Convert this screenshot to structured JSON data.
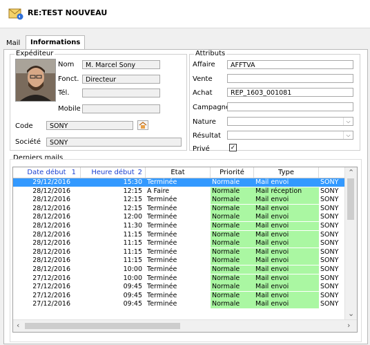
{
  "window": {
    "title": "RE:TEST NOUVEAU"
  },
  "tabs": [
    {
      "label": "Mail"
    },
    {
      "label": "Informations"
    }
  ],
  "expediteur": {
    "title": "Expéditeur",
    "nom_label": "Nom",
    "nom": "M. Marcel Sony",
    "fonct_label": "Fonct.",
    "fonct": "Directeur",
    "tel_label": "Tél.",
    "tel": "",
    "mobile_label": "Mobile",
    "mobile": "",
    "code_label": "Code",
    "code": "SONY",
    "societe_label": "Société",
    "societe": "SONY"
  },
  "attributs": {
    "title": "Attributs",
    "affaire_label": "Affaire",
    "affaire": "AFFTVA",
    "vente_label": "Vente",
    "vente": "",
    "achat_label": "Achat",
    "achat": "REP_1603_001081",
    "campagne_label": "Campagne",
    "campagne": "",
    "nature_label": "Nature",
    "nature": "",
    "resultat_label": "Résultat",
    "resultat": "",
    "prive_label": "Privé",
    "prive_checked": true
  },
  "mails": {
    "title": "Derniers mails",
    "columns": [
      "Date début",
      "1",
      "Heure début",
      "2",
      "Etat",
      "Priorité",
      "Type"
    ],
    "rows": [
      {
        "date": "29/12/2016",
        "heure": "15:30",
        "etat": "Terminée",
        "priorite": "Normale",
        "type": "Mail envoi",
        "extra": "SONY",
        "selected": true
      },
      {
        "date": "28/12/2016",
        "heure": "12:15",
        "etat": "A Faire",
        "priorite": "Normale",
        "type": "Mail réception",
        "extra": "SONY"
      },
      {
        "date": "28/12/2016",
        "heure": "12:15",
        "etat": "Terminée",
        "priorite": "Normale",
        "type": "Mail envoi",
        "extra": "SONY"
      },
      {
        "date": "28/12/2016",
        "heure": "12:15",
        "etat": "Terminée",
        "priorite": "Normale",
        "type": "Mail envoi",
        "extra": "SONY"
      },
      {
        "date": "28/12/2016",
        "heure": "12:00",
        "etat": "Terminée",
        "priorite": "Normale",
        "type": "Mail envoi",
        "extra": "SONY"
      },
      {
        "date": "28/12/2016",
        "heure": "11:30",
        "etat": "Terminée",
        "priorite": "Normale",
        "type": "Mail envoi",
        "extra": "SONY"
      },
      {
        "date": "28/12/2016",
        "heure": "11:15",
        "etat": "Terminée",
        "priorite": "Normale",
        "type": "Mail envoi",
        "extra": "SONY"
      },
      {
        "date": "28/12/2016",
        "heure": "11:15",
        "etat": "Terminée",
        "priorite": "Normale",
        "type": "Mail envoi",
        "extra": "SONY"
      },
      {
        "date": "28/12/2016",
        "heure": "11:15",
        "etat": "Terminée",
        "priorite": "Normale",
        "type": "Mail envoi",
        "extra": "SONY"
      },
      {
        "date": "28/12/2016",
        "heure": "11:15",
        "etat": "Terminée",
        "priorite": "Normale",
        "type": "Mail envoi",
        "extra": "SONY"
      },
      {
        "date": "28/12/2016",
        "heure": "10:00",
        "etat": "Terminée",
        "priorite": "Normale",
        "type": "Mail envoi",
        "extra": "SONY"
      },
      {
        "date": "27/12/2016",
        "heure": "10:00",
        "etat": "Terminée",
        "priorite": "Normale",
        "type": "Mail envoi",
        "extra": "SONY"
      },
      {
        "date": "27/12/2016",
        "heure": "09:45",
        "etat": "Terminée",
        "priorite": "Normale",
        "type": "Mail envoi",
        "extra": "SONY"
      },
      {
        "date": "27/12/2016",
        "heure": "09:45",
        "etat": "Terminée",
        "priorite": "Normale",
        "type": "Mail envoi",
        "extra": "SONY"
      },
      {
        "date": "27/12/2016",
        "heure": "09:45",
        "etat": "Terminée",
        "priorite": "Normale",
        "type": "Mail envoi",
        "extra": "SONY"
      }
    ]
  },
  "colors": {
    "selected_row": "#3399ff",
    "green_cell": "#aaf7a2",
    "header_blue": "#1a3fcf"
  }
}
